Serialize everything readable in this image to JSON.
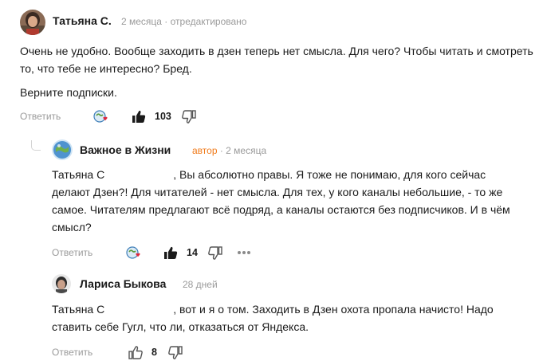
{
  "comments": [
    {
      "author": "Татьяна С.",
      "meta": "2 месяца · отредактировано",
      "paragraphs": [
        "Очень не удобно. Вообще заходить в дзен теперь нет смысла. Для чего? Чтобы читать и смотреть то, что тебе не интересно? Бред.",
        "Верните подписки."
      ],
      "reply_label": "Ответить",
      "likes": "103"
    },
    {
      "author": "Важное в Жизни",
      "role": "автор",
      "meta": "· 2 месяца",
      "mention": "Татьяна С",
      "text": ", Вы абсолютно правы. Я тоже не понимаю, для кого сейчас делают Дзен?! Для читателей - нет смысла. Для тех, у кого каналы небольшие, - то же самое. Читателям предлагают всё подряд, а каналы остаются без подписчиков. И в чём смысл?",
      "reply_label": "Ответить",
      "likes": "14"
    },
    {
      "author": "Лариса Быкова",
      "meta": "28 дней",
      "mention": "Татьяна С",
      "text": ", вот и я о том. Заходить в Дзен охота пропала начисто! Надо ставить себе Гугл, что ли, отказаться от Яндекса.",
      "reply_label": "Ответить",
      "likes": "8"
    }
  ],
  "icons": {
    "reactions": "reactions-icon",
    "like": "thumbs-up-icon",
    "dislike": "thumbs-down-icon",
    "more": "more-dots-icon"
  },
  "colors": {
    "author_role": "#f07a1a",
    "muted": "#9a9a9a",
    "text": "#1a1a1a"
  }
}
